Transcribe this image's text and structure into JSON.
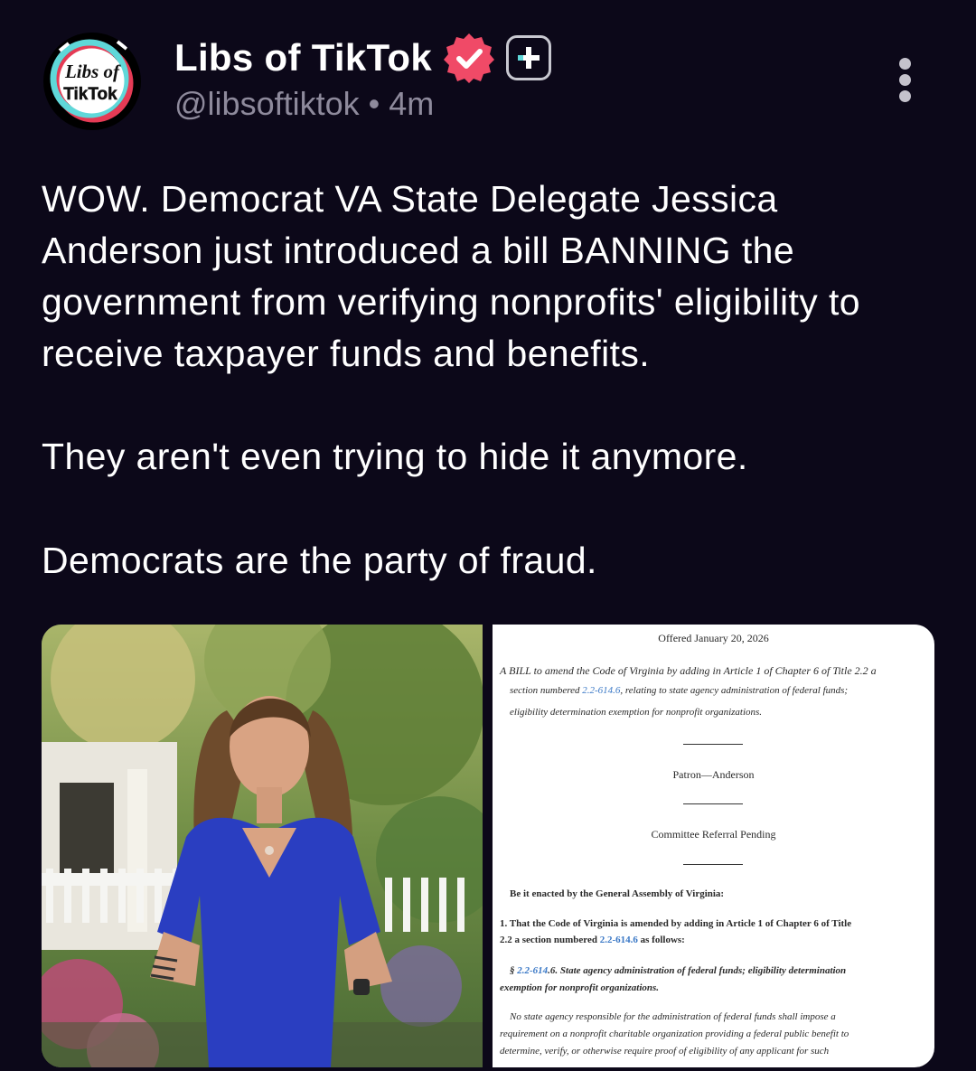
{
  "account": {
    "display_name": "Libs of TikTok",
    "handle": "@libsoftiktok",
    "separator": "•",
    "time_ago": "4m",
    "avatar_text_line1": "Libs of",
    "avatar_text_line2": "TikTok"
  },
  "icons": {
    "verified": "verified-badge-icon",
    "subscribe": "plus-subscribe-icon",
    "more": "more-vertical-icon"
  },
  "colors": {
    "background": "#0c0819",
    "verified_badge": "#f04a67",
    "handle_text": "#8e8a9c",
    "link": "#3a78c6"
  },
  "post": {
    "paragraph1": "WOW. Democrat VA State Delegate Jessica Anderson just introduced a bill BANNING the government from verifying nonprofits' eligibility to receive taxpayer funds and benefits.",
    "paragraph2": "They aren't even trying to hide it anymore.",
    "paragraph3": "Democrats are the party of fraud."
  },
  "document": {
    "offered": "Offered January 20, 2026",
    "bill_line1": "A BILL to amend the Code of Virginia by adding in Article 1 of Chapter 6 of Title 2.2 a",
    "bill_line2_pre": "section numbered ",
    "bill_line2_link": "2.2-614.6",
    "bill_line2_post": ", relating to state agency administration of federal funds;",
    "bill_line3": "eligibility determination exemption for nonprofit organizations.",
    "patron": "Patron—Anderson",
    "committee": "Committee Referral Pending",
    "enacted": "Be it enacted by the General Assembly of Virginia:",
    "sec1_line1": "1. That the Code of Virginia is amended by adding in Article 1 of Chapter 6 of Title",
    "sec1_line2_pre": "2.2 a section numbered ",
    "sec1_line2_link": "2.2-614.6",
    "sec1_line2_post": " as follows:",
    "section_symbol": "§ ",
    "section_link": "2.2-614",
    "section_line1_post": ".6. State agency administration of federal funds; eligibility determination",
    "section_line2": "exemption for nonprofit organizations.",
    "body_line1": "No state agency responsible for the administration of federal funds shall impose a",
    "body_line2": "requirement on a nonprofit charitable organization providing a federal public benefit to",
    "body_line3": "determine, verify, or otherwise require proof of eligibility of any applicant for such"
  }
}
